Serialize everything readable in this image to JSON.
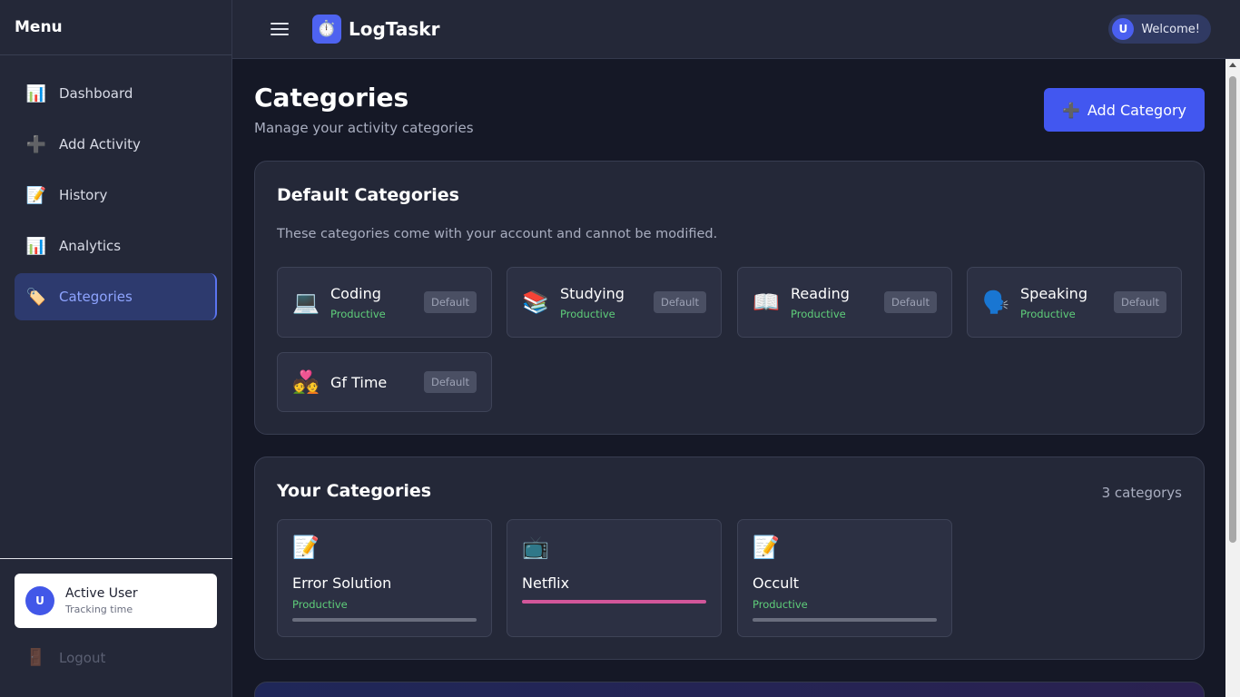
{
  "sidebar": {
    "title": "Menu",
    "items": [
      {
        "icon": "📊",
        "label": "Dashboard"
      },
      {
        "icon": "➕",
        "label": "Add Activity"
      },
      {
        "icon": "📝",
        "label": "History"
      },
      {
        "icon": "📊",
        "label": "Analytics"
      },
      {
        "icon": "🏷️",
        "label": "Categories"
      }
    ],
    "user": {
      "initial": "U",
      "name": "Active User",
      "status": "Tracking time"
    },
    "logout": {
      "icon": "🚪",
      "label": "Logout"
    }
  },
  "topbar": {
    "logo_icon": "⏱️",
    "brand": "LogTaskr",
    "welcome_initial": "U",
    "welcome_label": "Welcome!"
  },
  "page": {
    "title": "Categories",
    "subtitle": "Manage your activity categories",
    "add_button": {
      "icon": "➕",
      "label": "Add Category"
    }
  },
  "default_section": {
    "title": "Default Categories",
    "description": "These categories come with your account and cannot be modified.",
    "badge": "Default",
    "cards": [
      {
        "icon": "💻",
        "name": "Coding",
        "type": "Productive"
      },
      {
        "icon": "📚",
        "name": "Studying",
        "type": "Productive"
      },
      {
        "icon": "📖",
        "name": "Reading",
        "type": "Productive"
      },
      {
        "icon": "🗣️",
        "name": "Speaking",
        "type": "Productive"
      },
      {
        "icon": "💑",
        "name": "Gf Time",
        "type": ""
      }
    ]
  },
  "user_section": {
    "title": "Your Categories",
    "count": "3 categorys",
    "cards": [
      {
        "icon": "📝",
        "name": "Error Solution",
        "type": "Productive",
        "color": "#6a6e7e"
      },
      {
        "icon": "📺",
        "name": "Netflix",
        "type": "",
        "color": "#d2569a"
      },
      {
        "icon": "📝",
        "name": "Occult",
        "type": "Productive",
        "color": "#6a6e7e"
      }
    ]
  },
  "colors": {
    "accent": "#4257f0",
    "productive": "#5fce7a",
    "netflix": "#d2569a"
  }
}
